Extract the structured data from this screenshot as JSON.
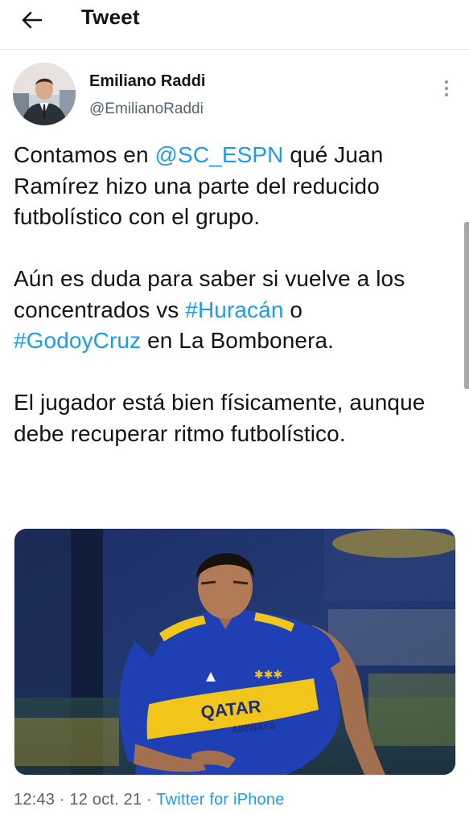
{
  "header": {
    "back_icon": "arrow-left-icon",
    "title": "Tweet"
  },
  "author": {
    "name": "Emiliano Raddi",
    "handle": "@EmilianoRaddi",
    "more_icon": "more-vertical-icon"
  },
  "tweet": {
    "p1": {
      "t1": "Contamos en ",
      "mention": "@SC_ESPN",
      "t2": " qué Juan Ramírez hizo una parte del reducido futbolístico con el grupo."
    },
    "p2": {
      "t1": "Aún es duda para saber si vuelve a los concentrados vs ",
      "hashtag1": "#Huracán",
      "t2": " o ",
      "hashtag2": "#GodoyCruz",
      "t3": " en La Bombonera."
    },
    "p3": {
      "t1": "El jugador está bien físicamente, aunque debe recuperar ritmo futbolístico."
    }
  },
  "media": {
    "shirt_sponsor_top": "QATAR",
    "shirt_sponsor_bottom": "AIRWAYS"
  },
  "meta": {
    "time": "12:43",
    "sep1": " · ",
    "date": "12 oct. 21",
    "sep2": " · ",
    "source": "Twitter for iPhone"
  },
  "colors": {
    "link": "#1d9bf0",
    "muted": "#536471",
    "jersey_blue": "#1f3fb4",
    "jersey_yellow": "#f2c51a"
  }
}
